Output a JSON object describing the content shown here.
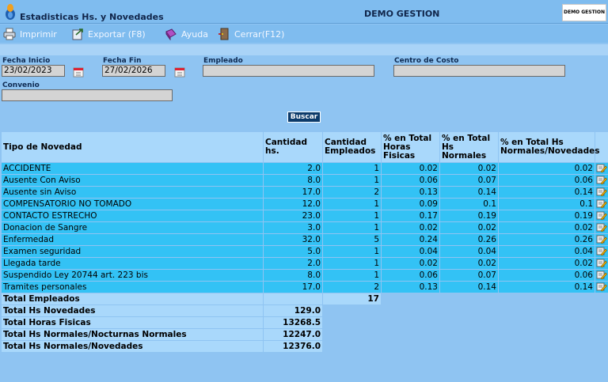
{
  "header": {
    "title": "Estadisticas Hs. y Novedades",
    "company": "DEMO GESTION",
    "brand": "DEMO GESTION"
  },
  "toolbar": {
    "print": "Imprimir",
    "export": "Exportar (F8)",
    "help": "Ayuda",
    "close": "Cerrar(F12)"
  },
  "filters": {
    "fecha_inicio_label": "Fecha Inicio",
    "fecha_inicio_value": "23/02/2023",
    "fecha_fin_label": "Fecha Fin",
    "fecha_fin_value": "27/02/2026",
    "empleado_label": "Empleado",
    "empleado_value": "",
    "centro_label": "Centro de Costo",
    "centro_value": "",
    "convenio_label": "Convenio",
    "convenio_value": "",
    "buscar": "Buscar"
  },
  "table": {
    "headers": [
      "Tipo de Novedad",
      "Cantidad hs.",
      "Cantidad Empleados",
      "% en Total Horas Fisicas",
      "% en Total Hs Normales",
      "% en Total Hs Normales/Novedades"
    ],
    "rows": [
      [
        "ACCIDENTE",
        "2.0",
        "1",
        "0.02",
        "0.02",
        "0.02"
      ],
      [
        "Ausente Con Aviso",
        "8.0",
        "1",
        "0.06",
        "0.07",
        "0.06"
      ],
      [
        "Ausente sin Aviso",
        "17.0",
        "2",
        "0.13",
        "0.14",
        "0.14"
      ],
      [
        "COMPENSATORIO NO TOMADO",
        "12.0",
        "1",
        "0.09",
        "0.1",
        "0.1"
      ],
      [
        "CONTACTO ESTRECHO",
        "23.0",
        "1",
        "0.17",
        "0.19",
        "0.19"
      ],
      [
        "Donacion de Sangre",
        "3.0",
        "1",
        "0.02",
        "0.02",
        "0.02"
      ],
      [
        "Enfermedad",
        "32.0",
        "5",
        "0.24",
        "0.26",
        "0.26"
      ],
      [
        "Examen seguridad",
        "5.0",
        "1",
        "0.04",
        "0.04",
        "0.04"
      ],
      [
        "Llegada tarde",
        "2.0",
        "1",
        "0.02",
        "0.02",
        "0.02"
      ],
      [
        "Suspendido Ley 20744 art. 223 bis",
        "8.0",
        "1",
        "0.06",
        "0.07",
        "0.06"
      ],
      [
        "Tramites personales",
        "17.0",
        "2",
        "0.13",
        "0.14",
        "0.14"
      ]
    ],
    "totals": {
      "empleados_label": "Total Empleados",
      "empleados_value": "17",
      "novedades_label": "Total Hs Novedades",
      "novedades_value": "129.0",
      "fisicas_label": "Total Horas Fisicas",
      "fisicas_value": "13268.5",
      "normales_label": "Total Hs Normales/Nocturnas Normales",
      "normales_value": "12247.0",
      "normnov_label": "Total Hs Normales/Novedades",
      "normnov_value": "12376.0"
    }
  },
  "colors": {
    "background": "#8fc4f2",
    "header_cell": "#a9d8fb",
    "row_cell": "#33c2f5",
    "button": "#0b3a6a"
  },
  "icons": [
    "app-logo-icon",
    "printer-icon",
    "export-icon",
    "help-book-icon",
    "exit-door-icon",
    "calendar-icon",
    "edit-note-icon"
  ]
}
